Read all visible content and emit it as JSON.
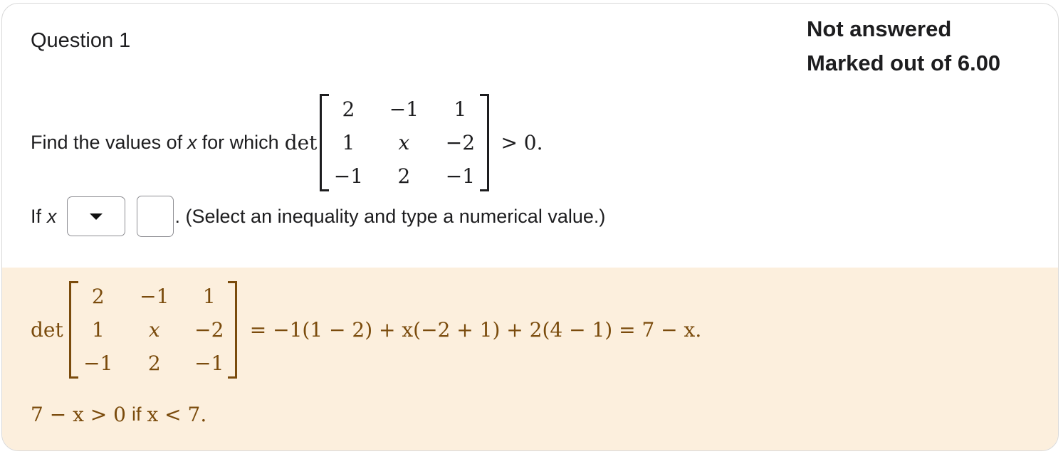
{
  "question": {
    "title": "Question 1",
    "status": "Not answered",
    "marks": "Marked out of 6.00"
  },
  "prompt": {
    "lead": "Find the values of",
    "var": "x",
    "for_which": "for which",
    "det": "det",
    "matrix": [
      [
        "2",
        "−1",
        "1"
      ],
      [
        "1",
        "x",
        "−2"
      ],
      [
        "−1",
        "2",
        "−1"
      ]
    ],
    "condition": "> 0."
  },
  "answer": {
    "if_label": "If",
    "var": "x",
    "select_value": "",
    "number_value": "",
    "instruction": ". (Select an inequality and type a numerical value.)"
  },
  "feedback": {
    "det": "det",
    "matrix": [
      [
        "2",
        "−1",
        "1"
      ],
      [
        "1",
        "x",
        "−2"
      ],
      [
        "−1",
        "2",
        "−1"
      ]
    ],
    "expansion": "= −1(1 − 2) + x(−2 + 1) + 2(4 − 1) = 7 − x.",
    "conclusion_lhs": "7 − x > 0",
    "conclusion_if": "if",
    "conclusion_rhs": "x < 7."
  },
  "colors": {
    "feedback_bg": "#fcefdd",
    "feedback_text": "#7a4b0c"
  }
}
